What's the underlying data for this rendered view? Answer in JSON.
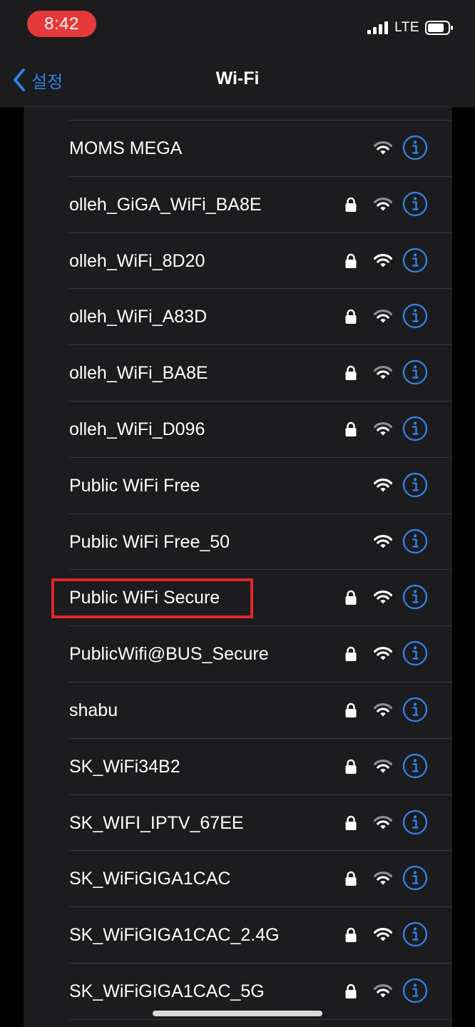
{
  "status_bar": {
    "time": "8:42",
    "network": "LTE",
    "signal_icon": "cellular-signal-icon",
    "battery_icon": "battery-icon",
    "colors": {
      "time_pill": "#e5393a"
    }
  },
  "nav": {
    "back_label": "설정",
    "back_icon": "chevron-left-icon",
    "title": "Wi-Fi",
    "accent": "#2f7fe0"
  },
  "networks": [
    {
      "name": "MOMS MEGA",
      "secured": false,
      "signal": "medium"
    },
    {
      "name": "olleh_GiGA_WiFi_BA8E",
      "secured": true,
      "signal": "medium"
    },
    {
      "name": "olleh_WiFi_8D20",
      "secured": true,
      "signal": "full"
    },
    {
      "name": "olleh_WiFi_A83D",
      "secured": true,
      "signal": "medium"
    },
    {
      "name": "olleh_WiFi_BA8E",
      "secured": true,
      "signal": "medium"
    },
    {
      "name": "olleh_WiFi_D096",
      "secured": true,
      "signal": "medium"
    },
    {
      "name": "Public WiFi Free",
      "secured": false,
      "signal": "full"
    },
    {
      "name": "Public WiFi Free_50",
      "secured": false,
      "signal": "full"
    },
    {
      "name": "Public WiFi Secure",
      "secured": true,
      "signal": "full",
      "highlighted": true
    },
    {
      "name": "PublicWifi@BUS_Secure",
      "secured": true,
      "signal": "full"
    },
    {
      "name": "shabu",
      "secured": true,
      "signal": "medium"
    },
    {
      "name": "SK_WiFi34B2",
      "secured": true,
      "signal": "medium"
    },
    {
      "name": "SK_WIFI_IPTV_67EE",
      "secured": true,
      "signal": "medium"
    },
    {
      "name": "SK_WiFiGIGA1CAC",
      "secured": true,
      "signal": "medium"
    },
    {
      "name": "SK_WiFiGIGA1CAC_2.4G",
      "secured": true,
      "signal": "full"
    },
    {
      "name": "SK_WiFiGIGA1CAC_5G",
      "secured": true,
      "signal": "medium"
    }
  ],
  "icons": {
    "lock": "lock-icon",
    "wifi": "wifi-icon",
    "info": "info-icon"
  },
  "highlight_color": "#e0262a"
}
